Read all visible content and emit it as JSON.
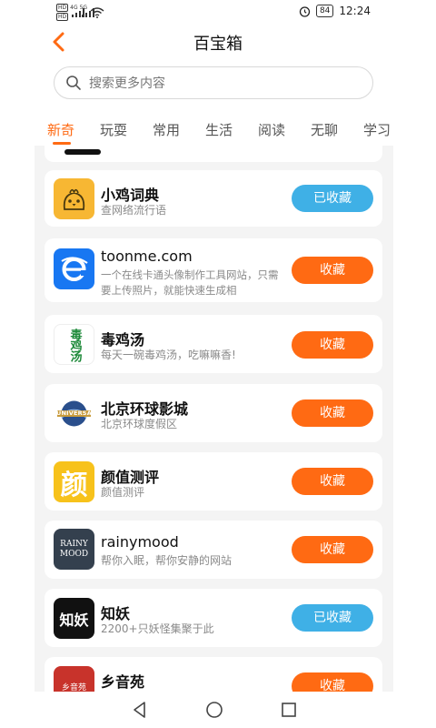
{
  "status_bar": {
    "sig1_a": "HD",
    "sig1_b": "HD",
    "net_4g": "4G",
    "net_5g": "5G",
    "battery": "84",
    "time": "12:24"
  },
  "header": {
    "title": "百宝箱"
  },
  "search": {
    "placeholder": "搜索更多内容"
  },
  "tabs": [
    "新奇",
    "玩耍",
    "常用",
    "生活",
    "阅读",
    "无聊",
    "学习"
  ],
  "items": [
    {
      "name": "小鸡词典",
      "desc": "查网络流行语",
      "button": "已收藏",
      "state": "collected",
      "logo_text": ""
    },
    {
      "name": "toonme.com",
      "desc": "一个在线卡通头像制作工具网站，只需\n要上传照片，就能快速生成相",
      "button": "收藏",
      "state": "normal",
      "logo_text": ""
    },
    {
      "name": "毒鸡汤",
      "desc": "每天一碗毒鸡汤，吃嘛嘛香!",
      "button": "收藏",
      "state": "normal",
      "logo_text": "毒鸡汤"
    },
    {
      "name": "北京环球影城",
      "desc": "北京环球度假区",
      "button": "收藏",
      "state": "normal",
      "logo_text": "UNIVERSAL"
    },
    {
      "name": "颜值测评",
      "desc": "颜值测评",
      "button": "收藏",
      "state": "normal",
      "logo_text": "颜"
    },
    {
      "name": "rainymood",
      "desc": "帮你入眠，帮你安静的网站",
      "button": "收藏",
      "state": "normal",
      "logo_text": "RAINY MOOD"
    },
    {
      "name": "知妖",
      "desc": "2200+只妖怪集聚于此",
      "button": "已收藏",
      "state": "collected",
      "logo_text": "知妖"
    },
    {
      "name": "乡音苑",
      "desc": "",
      "button": "收藏",
      "state": "normal",
      "logo_text": "乡音苑"
    }
  ],
  "colors": {
    "accent": "#ff6a13",
    "collected": "#3fb0e6"
  }
}
